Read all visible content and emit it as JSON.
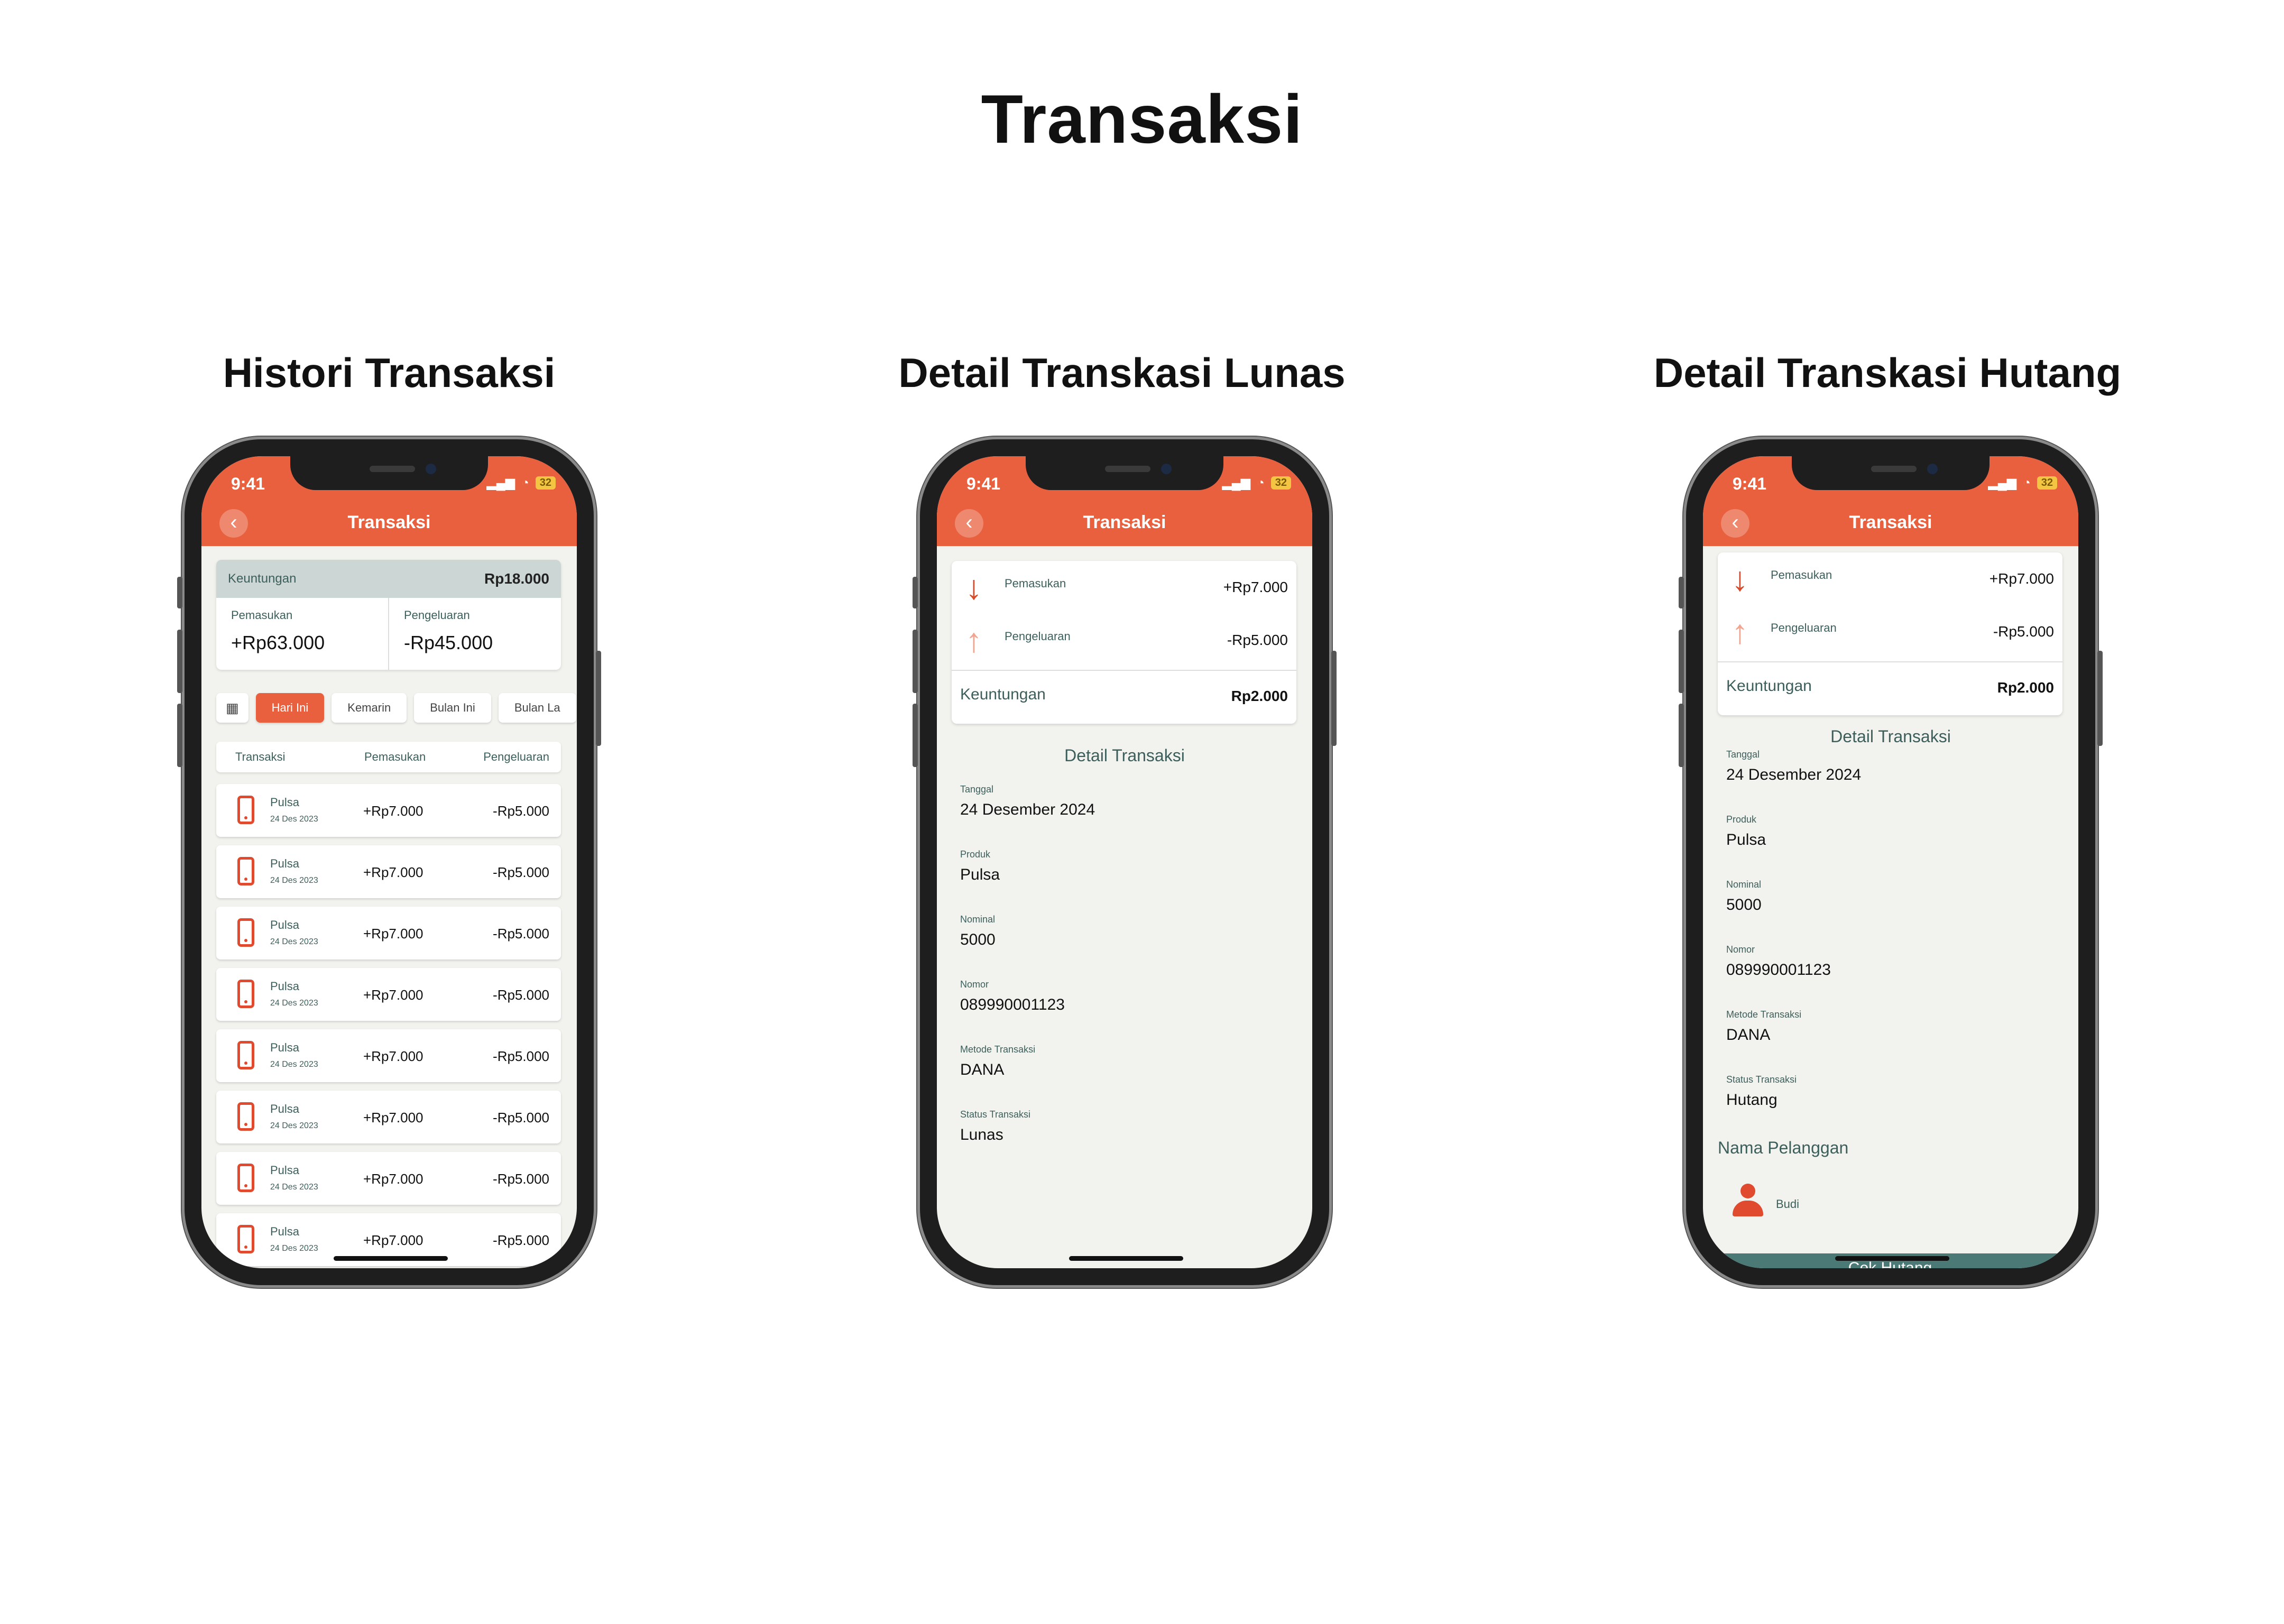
{
  "page": {
    "title": "Transaksi"
  },
  "sections": [
    {
      "title": "Histori Transaksi"
    },
    {
      "title": "Detail Transkasi Lunas"
    },
    {
      "title": "Detail Transkasi Hutang"
    }
  ],
  "status_bar": {
    "time": "9:41",
    "battery": "32"
  },
  "appbar": {
    "title": "Transaksi",
    "back_icon": "chevron-left-icon"
  },
  "history": {
    "profit_label": "Keuntungan",
    "profit_value": "Rp18.000",
    "income_label": "Pemasukan",
    "income_value": "+Rp63.000",
    "expense_label": "Pengeluaran",
    "expense_value": "-Rp45.000",
    "calendar_icon": "calendar-icon",
    "filters": [
      "Hari Ini",
      "Kemarin",
      "Bulan Ini",
      "Bulan La"
    ],
    "table_headers": [
      "Transaksi",
      "Pemasukan",
      "Pengeluaran"
    ],
    "rows": [
      {
        "name": "Pulsa",
        "date": "24 Des 2023",
        "income": "+Rp7.000",
        "expense": "-Rp5.000"
      },
      {
        "name": "Pulsa",
        "date": "24 Des 2023",
        "income": "+Rp7.000",
        "expense": "-Rp5.000"
      },
      {
        "name": "Pulsa",
        "date": "24 Des 2023",
        "income": "+Rp7.000",
        "expense": "-Rp5.000"
      },
      {
        "name": "Pulsa",
        "date": "24 Des 2023",
        "income": "+Rp7.000",
        "expense": "-Rp5.000"
      },
      {
        "name": "Pulsa",
        "date": "24 Des 2023",
        "income": "+Rp7.000",
        "expense": "-Rp5.000"
      },
      {
        "name": "Pulsa",
        "date": "24 Des 2023",
        "income": "+Rp7.000",
        "expense": "-Rp5.000"
      },
      {
        "name": "Pulsa",
        "date": "24 Des 2023",
        "income": "+Rp7.000",
        "expense": "-Rp5.000"
      },
      {
        "name": "Pulsa",
        "date": "24 Des 2023",
        "income": "+Rp7.000",
        "expense": "-Rp5.000"
      }
    ]
  },
  "detail_lunas": {
    "income_label": "Pemasukan",
    "income_value": "+Rp7.000",
    "expense_label": "Pengeluaran",
    "expense_value": "-Rp5.000",
    "profit_label": "Keuntungan",
    "profit_value": "Rp2.000",
    "section_title": "Detail Transaksi",
    "fields": [
      {
        "label": "Tanggal",
        "value": "24 Desember 2024"
      },
      {
        "label": "Produk",
        "value": "Pulsa"
      },
      {
        "label": "Nominal",
        "value": "5000"
      },
      {
        "label": "Nomor",
        "value": "089990001123"
      },
      {
        "label": "Metode Transaksi",
        "value": "DANA"
      },
      {
        "label": "Status Transaksi",
        "value": "Lunas"
      }
    ]
  },
  "detail_hutang": {
    "income_label": "Pemasukan",
    "income_value": "+Rp7.000",
    "expense_label": "Pengeluaran",
    "expense_value": "-Rp5.000",
    "profit_label": "Keuntungan",
    "profit_value": "Rp2.000",
    "section_title": "Detail Transaksi",
    "fields": [
      {
        "label": "Tanggal",
        "value": "24 Desember 2024"
      },
      {
        "label": "Produk",
        "value": "Pulsa"
      },
      {
        "label": "Nominal",
        "value": "5000"
      },
      {
        "label": "Nomor",
        "value": "089990001123"
      },
      {
        "label": "Metode Transaksi",
        "value": "DANA"
      },
      {
        "label": "Status Transaksi",
        "value": "Hutang"
      }
    ],
    "customer_heading": "Nama Pelanggan",
    "customer_name": "Budi",
    "button_label": "Cek Hutang"
  },
  "colors": {
    "accent": "#e9603e",
    "teal": "#3d5f5c",
    "button": "#4b7a76",
    "background": "#f2f3ee"
  }
}
